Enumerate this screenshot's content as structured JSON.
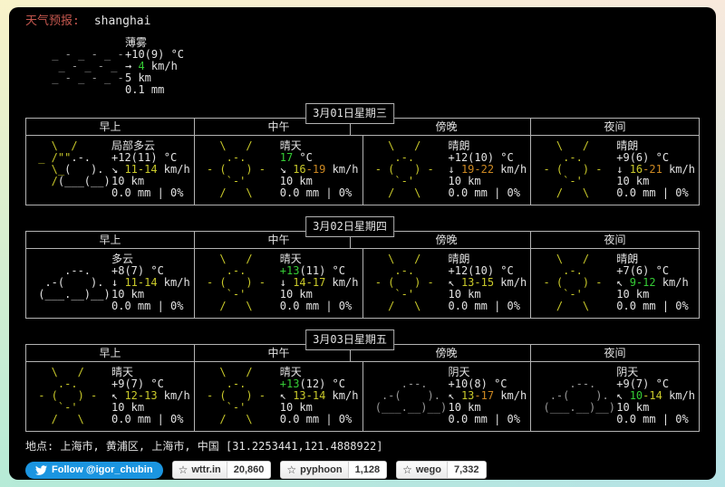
{
  "header": {
    "label": "天气预报:",
    "query": "shanghai"
  },
  "current": {
    "art": "mist",
    "desc": "薄雾",
    "temp": [
      [
        "+10(9) °C",
        "w"
      ]
    ],
    "wind": [
      [
        "→ ",
        "w"
      ],
      [
        "4",
        "green"
      ],
      [
        " km/h",
        "w"
      ]
    ],
    "vis": "5 km",
    "precip": "0.1 mm"
  },
  "columns": [
    "早上",
    "中午",
    "傍晚",
    "夜间"
  ],
  "days": [
    {
      "date": "3月01日星期三",
      "cells": [
        {
          "art": "partly_cloudy",
          "desc": "局部多云",
          "temp": [
            [
              "+12(11) °C",
              "w"
            ]
          ],
          "wind": [
            [
              "↘ ",
              "w"
            ],
            [
              "11-14",
              "yellow"
            ],
            [
              " km/h",
              "w"
            ]
          ],
          "vis": "10 km",
          "precip": "0.0 mm | 0%"
        },
        {
          "art": "sunny",
          "desc": "晴天",
          "temp": [
            [
              "17",
              "green"
            ],
            [
              " °C",
              "w"
            ]
          ],
          "wind": [
            [
              "↘ ",
              "w"
            ],
            [
              "16",
              "yellow"
            ],
            [
              "-19",
              "orange"
            ],
            [
              " km/h",
              "w"
            ]
          ],
          "vis": "10 km",
          "precip": "0.0 mm | 0%"
        },
        {
          "art": "sunny",
          "desc": "晴朗",
          "temp": [
            [
              "+12(10) °C",
              "w"
            ]
          ],
          "wind": [
            [
              "↓ ",
              "w"
            ],
            [
              "19-22",
              "orange"
            ],
            [
              " km/h",
              "w"
            ]
          ],
          "vis": "10 km",
          "precip": "0.0 mm | 0%"
        },
        {
          "art": "sunny",
          "desc": "晴朗",
          "temp": [
            [
              "+9(6) °C",
              "w"
            ]
          ],
          "wind": [
            [
              "↓ ",
              "w"
            ],
            [
              "16",
              "yellow"
            ],
            [
              "-21",
              "orange"
            ],
            [
              " km/h",
              "w"
            ]
          ],
          "vis": "10 km",
          "precip": "0.0 mm | 0%"
        }
      ]
    },
    {
      "date": "3月02日星期四",
      "cells": [
        {
          "art": "cloudy",
          "desc": "多云",
          "temp": [
            [
              "+8(7) °C",
              "w"
            ]
          ],
          "wind": [
            [
              "↓ ",
              "w"
            ],
            [
              "11-14",
              "yellow"
            ],
            [
              " km/h",
              "w"
            ]
          ],
          "vis": "10 km",
          "precip": "0.0 mm | 0%"
        },
        {
          "art": "sunny",
          "desc": "晴天",
          "temp": [
            [
              "+13",
              "green"
            ],
            [
              "(11) °C",
              "w"
            ]
          ],
          "wind": [
            [
              "↓ ",
              "w"
            ],
            [
              "14-17",
              "yellow"
            ],
            [
              " km/h",
              "w"
            ]
          ],
          "vis": "10 km",
          "precip": "0.0 mm | 0%"
        },
        {
          "art": "sunny",
          "desc": "晴朗",
          "temp": [
            [
              "+12(10) °C",
              "w"
            ]
          ],
          "wind": [
            [
              "↖ ",
              "w"
            ],
            [
              "13-15",
              "yellow"
            ],
            [
              " km/h",
              "w"
            ]
          ],
          "vis": "10 km",
          "precip": "0.0 mm | 0%"
        },
        {
          "art": "sunny",
          "desc": "晴朗",
          "temp": [
            [
              "+7(6) °C",
              "w"
            ]
          ],
          "wind": [
            [
              "↖ ",
              "w"
            ],
            [
              "9-12",
              "green"
            ],
            [
              " km/h",
              "w"
            ]
          ],
          "vis": "10 km",
          "precip": "0.0 mm | 0%"
        }
      ]
    },
    {
      "date": "3月03日星期五",
      "cells": [
        {
          "art": "sunny",
          "desc": "晴天",
          "temp": [
            [
              "+9(7) °C",
              "w"
            ]
          ],
          "wind": [
            [
              "↖ ",
              "w"
            ],
            [
              "12-13",
              "yellow"
            ],
            [
              " km/h",
              "w"
            ]
          ],
          "vis": "10 km",
          "precip": "0.0 mm | 0%"
        },
        {
          "art": "sunny",
          "desc": "晴天",
          "temp": [
            [
              "+13",
              "green"
            ],
            [
              "(12) °C",
              "w"
            ]
          ],
          "wind": [
            [
              "↖ ",
              "w"
            ],
            [
              "13-14",
              "yellow"
            ],
            [
              " km/h",
              "w"
            ]
          ],
          "vis": "10 km",
          "precip": "0.0 mm | 0%"
        },
        {
          "art": "overcast",
          "desc": "阴天",
          "temp": [
            [
              "+10(8) °C",
              "w"
            ]
          ],
          "wind": [
            [
              "↖ ",
              "w"
            ],
            [
              "13",
              "yellow"
            ],
            [
              "-17",
              "orange"
            ],
            [
              " km/h",
              "w"
            ]
          ],
          "vis": "10 km",
          "precip": "0.0 mm | 0%"
        },
        {
          "art": "overcast",
          "desc": "阴天",
          "temp": [
            [
              "+9(7) °C",
              "w"
            ]
          ],
          "wind": [
            [
              "↖ ",
              "w"
            ],
            [
              "10",
              "green"
            ],
            [
              "-14",
              "yellow"
            ],
            [
              " km/h",
              "w"
            ]
          ],
          "vis": "10 km",
          "precip": "0.0 mm | 0%"
        }
      ]
    }
  ],
  "arts": {
    "sunny": [
      [
        [
          "   \\   /",
          "y"
        ]
      ],
      [
        [
          "    .-.",
          "y"
        ]
      ],
      [
        [
          " - (   ) -",
          "y"
        ]
      ],
      [
        [
          "    `-'",
          "y"
        ]
      ],
      [
        [
          "   /   \\",
          "y"
        ]
      ]
    ],
    "partly_cloudy": [
      [
        [
          "   \\  /",
          "y"
        ]
      ],
      [
        [
          " _ /\"\"",
          "y"
        ],
        [
          ".-.",
          "w"
        ]
      ],
      [
        [
          "   \\_",
          "y"
        ],
        [
          "(   ).",
          "w"
        ]
      ],
      [
        [
          "   /",
          "y"
        ],
        [
          "(___(__)",
          "w"
        ]
      ],
      []
    ],
    "cloudy": [
      [],
      [
        [
          "     .--.",
          "w"
        ]
      ],
      [
        [
          "  .-(    ).",
          "w"
        ]
      ],
      [
        [
          " (___.__)__)",
          "w"
        ]
      ],
      []
    ],
    "overcast": [
      [],
      [
        [
          "     .--.",
          "g"
        ]
      ],
      [
        [
          "  .-(    ).",
          "g"
        ]
      ],
      [
        [
          " (___.__)__)",
          "g"
        ]
      ],
      []
    ],
    "mist": [
      [],
      [
        [
          " _ - _ - _ -",
          "g"
        ]
      ],
      [
        [
          "  _ - _ - _",
          "g"
        ]
      ],
      [
        [
          " _ - _ - _ -",
          "g"
        ]
      ],
      []
    ]
  },
  "location": "地点: 上海市, 黄浦区, 上海市, 中国 [31.2253441,121.4888922]",
  "footer": {
    "twitter_label": "Follow @igor_chubin",
    "star_icon": "☆",
    "badges": [
      {
        "label": "wttr.in",
        "count": "20,860"
      },
      {
        "label": "pyphoon",
        "count": "1,128"
      },
      {
        "label": "wego",
        "count": "7,332"
      }
    ]
  },
  "colors": {
    "terminal-bg": "#000000",
    "border": "#b3b3b3",
    "text": "#e3e3e3",
    "gray": "#999999",
    "yellow": "#c9c92a",
    "green": "#35cc35",
    "orange": "#cc8822",
    "title": "#c4574e",
    "twitter": "#1b95e0"
  }
}
